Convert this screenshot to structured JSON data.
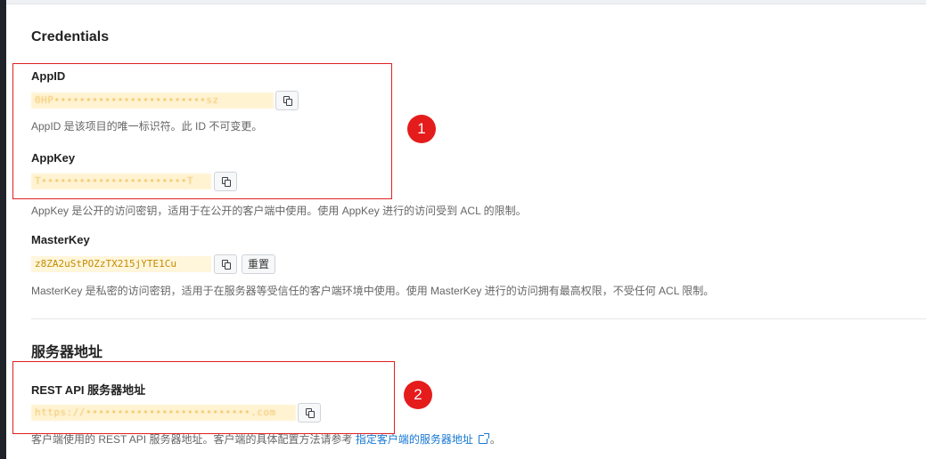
{
  "credentials": {
    "title": "Credentials",
    "appid": {
      "label": "AppID",
      "value": "0HP••••••••••••••••••••••••sz",
      "help": "AppID 是该项目的唯一标识符。此 ID 不可变更。"
    },
    "appkey": {
      "label": "AppKey",
      "value": "T•••••••••••••••••••••••T",
      "help": "AppKey 是公开的访问密钥，适用于在公开的客户端中使用。使用 AppKey 进行的访问受到 ACL 的限制。"
    },
    "masterkey": {
      "label": "MasterKey",
      "value": "z8ZA2uStPOZzTX215jYTE1Cu",
      "reset_label": "重置",
      "help": "MasterKey 是私密的访问密钥，适用于在服务器等受信任的客户端环境中使用。使用 MasterKey 进行的访问拥有最高权限，不受任何 ACL 限制。"
    }
  },
  "server": {
    "title": "服务器地址",
    "rest_api": {
      "label": "REST API 服务器地址",
      "value": "https://••••••••••••••••••••••••••.com",
      "help_prefix": "客户端使用的 REST API 服务器地址。客户端的具体配置方法请参考",
      "help_link": "指定客户端的服务器地址",
      "help_suffix": "。"
    }
  },
  "annotations": {
    "marker1": "1",
    "marker2": "2"
  },
  "colors": {
    "annotation_red": "#e51c1c",
    "code_text": "#c58a00",
    "link": "#1677d2"
  },
  "icons": {
    "copy": "copy-icon",
    "external_link": "external-link-icon"
  }
}
